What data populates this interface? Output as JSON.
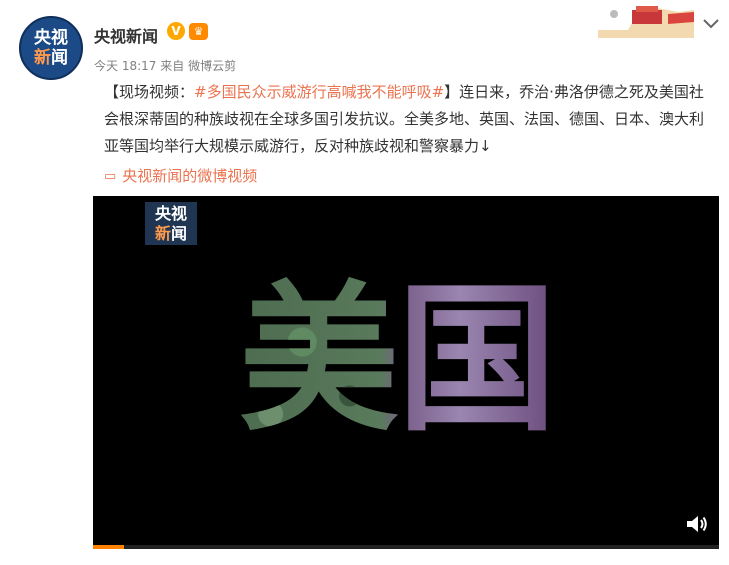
{
  "post": {
    "account_name": "央视新闻",
    "avatar_line1": "央视",
    "avatar_line2a": "新",
    "avatar_line2b": "闻",
    "verified_badge": "V",
    "time": "今天 18:17",
    "source_prefix": "来自",
    "source": "微博云剪",
    "text_open": "【现场视频：",
    "topic": "#多国民众示威游行高喊我不能呼吸#",
    "text_body": "】连日来，乔治·弗洛伊德之死及美国社会根深蒂固的种族歧视在全球多国引发抗议。全美多地、英国、法国、德国、日本、澳大利亚等国均举行大规模示威游行，反对种族歧视和警察暴力↓",
    "video_link_icon": "video-link-icon",
    "video_link_text": "央视新闻的微博视频"
  },
  "video": {
    "logo_line1": "央视",
    "logo_line2a": "新",
    "logo_line2b": "闻",
    "overlay_text": "美国",
    "progress": 0.05,
    "volume_icon": "speaker-icon"
  },
  "colors": {
    "accent": "#eb7350",
    "verified": "#ffa800",
    "progress": "#ff8200"
  }
}
